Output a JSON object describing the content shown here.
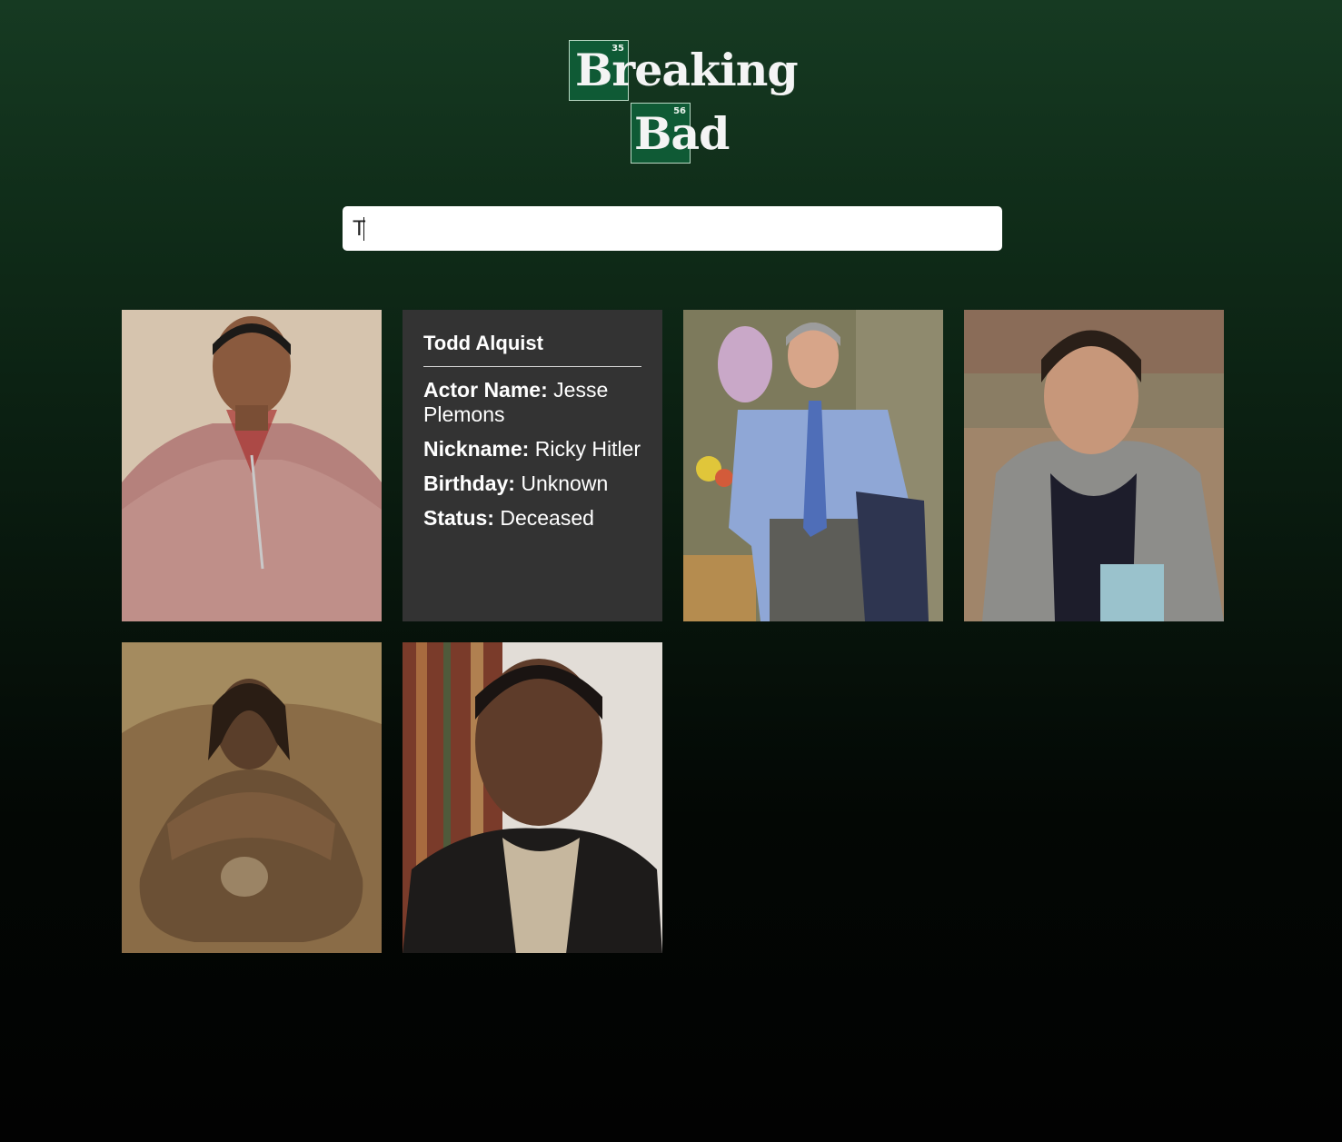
{
  "logo": {
    "box1": {
      "number": "35",
      "symbol": "Br"
    },
    "word1_rest": "eaking",
    "box2": {
      "number": "56",
      "symbol": "Ba"
    },
    "word2_rest": "d"
  },
  "search": {
    "value": "T",
    "placeholder": ""
  },
  "colors": {
    "background_top": "#163a22",
    "background_bottom": "#020202",
    "card_back": "#333333",
    "logo_tile": "#0f5a35"
  },
  "cards": [
    {
      "type": "portrait"
    },
    {
      "type": "details",
      "name": "Todd Alquist",
      "actor_label": "Actor Name:",
      "actor_value": "Jesse Plemons",
      "nickname_label": "Nickname:",
      "nickname_value": "Ricky Hitler",
      "birthday_label": "Birthday:",
      "birthday_value": "Unknown",
      "status_label": "Status:",
      "status_value": "Deceased"
    },
    {
      "type": "portrait"
    },
    {
      "type": "portrait"
    },
    {
      "type": "portrait"
    },
    {
      "type": "portrait"
    }
  ]
}
